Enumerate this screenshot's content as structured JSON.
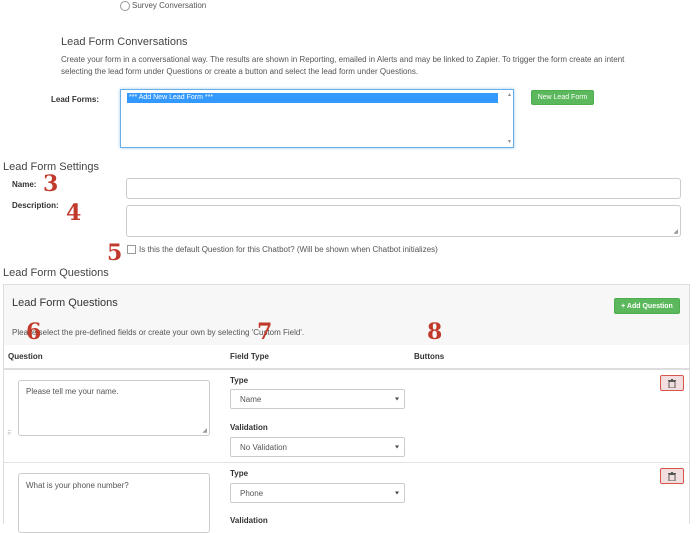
{
  "top": {
    "radio_label": "Survey Conversation"
  },
  "lead_form_conversations": {
    "title": "Lead Form Conversations",
    "description_line1": "Create your form in a conversational way. The results are shown in Reporting, emailed in Alerts and may be linked to Zapier. To trigger the form create an intent",
    "description_line2": "selecting the lead form under Questions or create a button and select the lead form under Questions.",
    "lead_forms_label": "Lead Forms:",
    "listbox_selected": "*** Add New Lead Form ***",
    "new_button": "New Lead Form"
  },
  "settings": {
    "title": "Lead Form Settings",
    "name_label": "Name:",
    "description_label": "Description:",
    "default_checkbox_label": "Is this the default Question for this Chatbot? (Will be shown when Chatbot initializes)"
  },
  "annotations": {
    "n3": "3",
    "n4": "4",
    "n5": "5",
    "n6": "6",
    "n7": "7",
    "n8": "8"
  },
  "questions": {
    "outer_title": "Lead Form Questions",
    "panel_title": "Lead Form Questions",
    "add_button": "+ Add Question",
    "instructions": "Please select the pre-defined fields or create your own by selecting 'Custom Field'.",
    "columns": [
      "Question",
      "Field Type",
      "Buttons"
    ],
    "rows": [
      {
        "question": "Please tell me your name.",
        "type_label": "Type",
        "type_value": "Name",
        "validation_label": "Validation",
        "validation_value": "No Validation"
      },
      {
        "question": "What is your phone number?",
        "type_label": "Type",
        "type_value": "Phone",
        "validation_label": "Validation",
        "validation_value": ""
      }
    ]
  }
}
